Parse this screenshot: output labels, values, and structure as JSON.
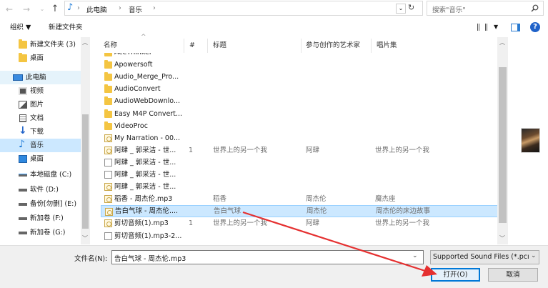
{
  "address": {
    "path": [
      "此电脑",
      "音乐"
    ],
    "search_placeholder": "搜索\"音乐\""
  },
  "toolbar": {
    "organize": "组织 ▼",
    "new_folder": "新建文件夹"
  },
  "sidebar": {
    "items": [
      {
        "label": "新建文件夹 (3)",
        "icon": "folder-icon"
      },
      {
        "label": "桌面",
        "icon": "folder-icon"
      },
      {
        "label": "此电脑",
        "icon": "computer-icon"
      },
      {
        "label": "视频",
        "icon": "video-icon"
      },
      {
        "label": "图片",
        "icon": "picture-icon"
      },
      {
        "label": "文档",
        "icon": "document-icon"
      },
      {
        "label": "下载",
        "icon": "download-icon"
      },
      {
        "label": "音乐",
        "icon": "music-icon"
      },
      {
        "label": "桌面",
        "icon": "desktop-icon"
      },
      {
        "label": "本地磁盘 (C:)",
        "icon": "drive-icon"
      },
      {
        "label": "软件 (D:)",
        "icon": "drive-icon"
      },
      {
        "label": "备份[勿删] (E:)",
        "icon": "drive-icon"
      },
      {
        "label": "新加卷 (F:)",
        "icon": "drive-icon"
      },
      {
        "label": "新加卷 (G:)",
        "icon": "drive-icon"
      }
    ]
  },
  "columns": {
    "name": "名称",
    "number": "#",
    "title": "标题",
    "artist": "参与创作的艺术家",
    "album": "唱片集"
  },
  "files": [
    {
      "name": "AceThinker",
      "num": "",
      "title": "",
      "artist": "",
      "album": "",
      "type": "folder"
    },
    {
      "name": "Apowersoft",
      "num": "",
      "title": "",
      "artist": "",
      "album": "",
      "type": "folder"
    },
    {
      "name": "Audio_Merge_Pro...",
      "num": "",
      "title": "",
      "artist": "",
      "album": "",
      "type": "folder"
    },
    {
      "name": "AudioConvert",
      "num": "",
      "title": "",
      "artist": "",
      "album": "",
      "type": "folder"
    },
    {
      "name": "AudioWebDownlo...",
      "num": "",
      "title": "",
      "artist": "",
      "album": "",
      "type": "folder"
    },
    {
      "name": "Easy M4P Convert...",
      "num": "",
      "title": "",
      "artist": "",
      "album": "",
      "type": "folder"
    },
    {
      "name": "VideoProc",
      "num": "",
      "title": "",
      "artist": "",
      "album": "",
      "type": "folder"
    },
    {
      "name": "My Narration - 00...",
      "num": "",
      "title": "",
      "artist": "",
      "album": "",
      "type": "mp3"
    },
    {
      "name": "阿肆 _ 郭采洁 - 世...",
      "num": "1",
      "title": "世界上的另一个我",
      "artist": "阿肆",
      "album": "世界上的另一个我",
      "type": "mp3"
    },
    {
      "name": "阿肆 _ 郭采洁 - 世...",
      "num": "",
      "title": "",
      "artist": "",
      "album": "",
      "type": "doc"
    },
    {
      "name": "阿肆 _ 郭采洁 - 世...",
      "num": "",
      "title": "",
      "artist": "",
      "album": "",
      "type": "doc"
    },
    {
      "name": "阿肆 _ 郭采洁 - 世...",
      "num": "",
      "title": "",
      "artist": "",
      "album": "",
      "type": "mp3"
    },
    {
      "name": "稻香 - 周杰伦.mp3",
      "num": "",
      "title": "稻香",
      "artist": "周杰伦",
      "album": "魔杰座",
      "type": "mp3"
    },
    {
      "name": "告白气球 - 周杰伦....",
      "num": "",
      "title": "告白气球",
      "artist": "周杰伦",
      "album": "周杰伦的床边故事",
      "type": "mp3"
    },
    {
      "name": "剪切音频(1).mp3",
      "num": "1",
      "title": "世界上的另一个我",
      "artist": "阿肆",
      "album": "世界上的另一个我",
      "type": "mp3"
    },
    {
      "name": "剪切音频(1).mp3-2...",
      "num": "",
      "title": "",
      "artist": "",
      "album": "",
      "type": "doc"
    }
  ],
  "selected_index": 13,
  "footer": {
    "filename_label": "文件名(N):",
    "filename_value": "告白气球 - 周杰伦.mp3",
    "filetype": "Supported Sound Files (*.pcı",
    "open_button": "打开(O)",
    "cancel_button": "取消"
  },
  "colors": {
    "selection_bg": "#cce8ff",
    "selection_border": "#99d1ff",
    "accent_blue": "#0078d7",
    "arrow_red": "#e53030",
    "folder_yellow": "#f4c542"
  }
}
